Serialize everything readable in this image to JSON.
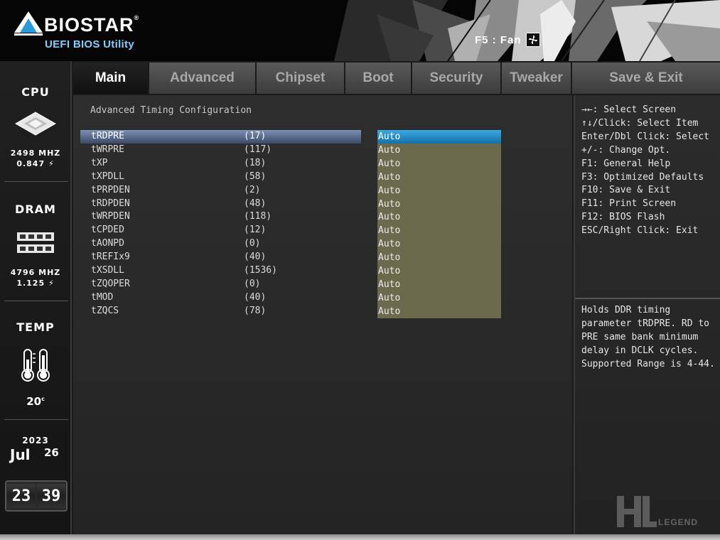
{
  "header": {
    "brand": "BIOSTAR",
    "brand_mark": "®",
    "subtitle": "UEFI BIOS Utility",
    "fan_hint": "F5 : Fan",
    "fan_icon": "fan-icon"
  },
  "sidebar": {
    "cpu": {
      "title": "CPU",
      "freq": "2498 MHZ",
      "volt": "0.847",
      "volt_icon": "lightning-icon"
    },
    "dram": {
      "title": "DRAM",
      "freq": "4796 MHZ",
      "volt": "1.125",
      "volt_icon": "lightning-icon"
    },
    "temp": {
      "title": "TEMP",
      "value": "20",
      "unit": "c"
    },
    "date": {
      "year": "2023",
      "month": "Jul",
      "day": "26"
    },
    "clock": {
      "hours": "23",
      "minutes": "39"
    }
  },
  "tabs": [
    {
      "label": "Main",
      "active": true
    },
    {
      "label": "Advanced",
      "active": false
    },
    {
      "label": "Chipset",
      "active": false
    },
    {
      "label": "Boot",
      "active": false
    },
    {
      "label": "Security",
      "active": false
    },
    {
      "label": "Tweaker",
      "active": false
    },
    {
      "label": "Save & Exit",
      "active": false
    }
  ],
  "main": {
    "section_title": "Advanced Timing Configuration",
    "rows": [
      {
        "name": "tRDPRE",
        "current": "(17)",
        "option": "Auto",
        "selected": true
      },
      {
        "name": "tWRPRE",
        "current": "(117)",
        "option": "Auto"
      },
      {
        "name": "tXP",
        "current": "(18)",
        "option": "Auto"
      },
      {
        "name": "tXPDLL",
        "current": "(58)",
        "option": "Auto"
      },
      {
        "name": "tPRPDEN",
        "current": "(2)",
        "option": "Auto"
      },
      {
        "name": "tRDPDEN",
        "current": "(48)",
        "option": "Auto"
      },
      {
        "name": "tWRPDEN",
        "current": "(118)",
        "option": "Auto"
      },
      {
        "name": "tCPDED",
        "current": "(12)",
        "option": "Auto"
      },
      {
        "name": "tAONPD",
        "current": "(0)",
        "option": "Auto"
      },
      {
        "name": "tREFIx9",
        "current": "(40)",
        "option": "Auto"
      },
      {
        "name": "tXSDLL",
        "current": "(1536)",
        "option": "Auto"
      },
      {
        "name": "tZQOPER",
        "current": "(0)",
        "option": "Auto"
      },
      {
        "name": "tMOD",
        "current": "(40)",
        "option": "Auto"
      },
      {
        "name": "tZQCS",
        "current": "(78)",
        "option": "Auto"
      }
    ]
  },
  "help": {
    "keys": [
      "→←: Select Screen",
      "↑↓/Click: Select Item",
      "Enter/Dbl Click: Select",
      "+/-: Change Opt.",
      "F1: General Help",
      "F3: Optimized Defaults",
      "F10: Save & Exit",
      "F11: Print Screen",
      "F12: BIOS Flash",
      "ESC/Right Click: Exit"
    ],
    "description": "Holds DDR timing parameter tRDPRE. RD to PRE same bank minimum delay in DCLK cycles. Supported Range is 4-44."
  },
  "watermark": {
    "word": "LEGEND"
  },
  "colors": {
    "option_bg": "#6b6a4d",
    "selected_option": "#2a8fc9",
    "selected_row": "#5a6a8c",
    "accent_blue": "#7fd0ff"
  }
}
